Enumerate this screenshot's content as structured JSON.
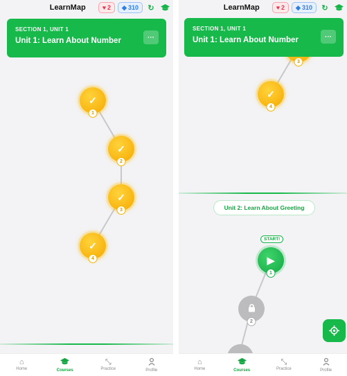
{
  "app": {
    "title": "LearnMap",
    "hearts": "2",
    "gems": "310"
  },
  "left": {
    "unit": {
      "section": "SECTION 1, UNIT 1",
      "title": "Unit 1: Learn About Number",
      "more": "···"
    },
    "lessons": [
      {
        "num": "1",
        "state": "done"
      },
      {
        "num": "2",
        "state": "done"
      },
      {
        "num": "3",
        "state": "done"
      },
      {
        "num": "4",
        "state": "done"
      }
    ]
  },
  "right": {
    "unit": {
      "section": "SECTION 1, UNIT 1",
      "title": "Unit 1: Learn About Number",
      "more": "···"
    },
    "prev_lessons": [
      {
        "num": "3",
        "state": "done"
      },
      {
        "num": "4",
        "state": "done"
      }
    ],
    "next_unit_label": "Unit 2: Learn About Greeting",
    "start_label": "START!",
    "lessons": [
      {
        "num": "1",
        "state": "active"
      },
      {
        "num": "2",
        "state": "locked"
      }
    ]
  },
  "nav": [
    {
      "label": "Home",
      "icon": "home-icon"
    },
    {
      "label": "Courses",
      "icon": "graduation-cap-icon"
    },
    {
      "label": "Practice",
      "icon": "expand-arrows-icon"
    },
    {
      "label": "Profile",
      "icon": "person-icon"
    }
  ],
  "colors": {
    "accent": "#16b94a",
    "gold": "#f5a800",
    "locked": "#bcbcbe"
  }
}
